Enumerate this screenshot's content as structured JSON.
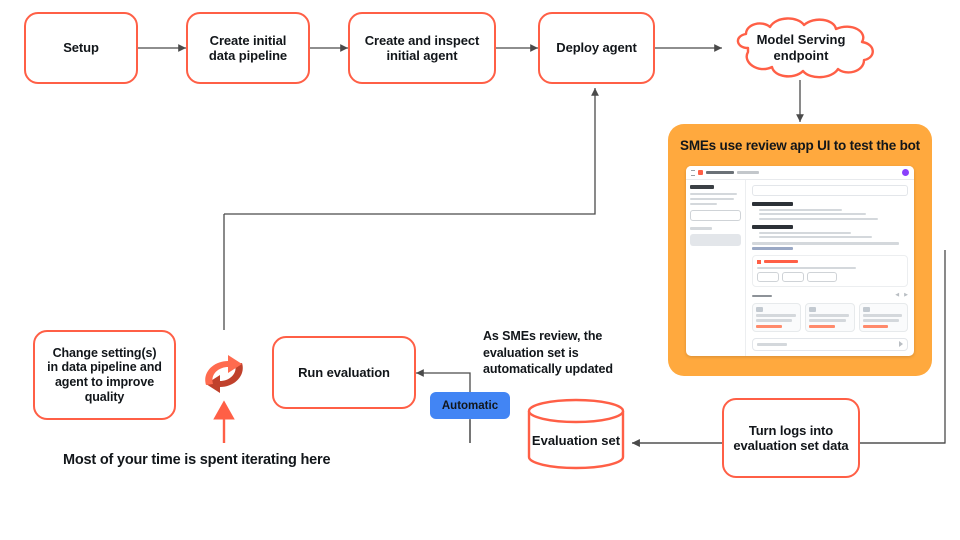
{
  "diagram": {
    "title": "Agent development and evaluation iteration loop",
    "colors": {
      "node_border": "#FF5F46",
      "panel_bg": "#FFA93E",
      "badge_bg": "#4285F4",
      "wire": "#4a4a4a",
      "accent_arrow": "#FF5F46",
      "cycle_dark": "#C0412C",
      "cycle_light": "#FF6B4F",
      "text": "#12161a"
    },
    "nodes": {
      "setup": "Setup",
      "create_pipeline": "Create initial\ndata pipeline",
      "create_agent": "Create and inspect\ninitial agent",
      "deploy_agent": "Deploy agent",
      "model_serving": "Model Serving\nendpoint",
      "run_evaluation": "Run evaluation",
      "change_settings": "Change setting(s)\nin data pipeline and\nagent to improve\nquality",
      "evaluation_set": "Evaluation set",
      "turn_logs": "Turn logs into\nevaluation set data"
    },
    "badges": {
      "automatic": "Automatic"
    },
    "panel": {
      "title": "SMEs use review app UI to test the bot",
      "screenshot": {
        "app_name": "review app screenshot",
        "icons": [
          "hamburger-icon",
          "app-logo-icon",
          "user-avatar-icon",
          "send-icon"
        ]
      }
    },
    "annotations": {
      "smes_review": "As SMEs review, the\nevaluation set is\nautomatically updated",
      "iterating_caption": "Most of your time is spent iterating here"
    },
    "icons": {
      "cycle": "refresh-cycle-icon",
      "cloud": "cloud-icon",
      "cylinder": "database-cylinder-icon"
    }
  }
}
